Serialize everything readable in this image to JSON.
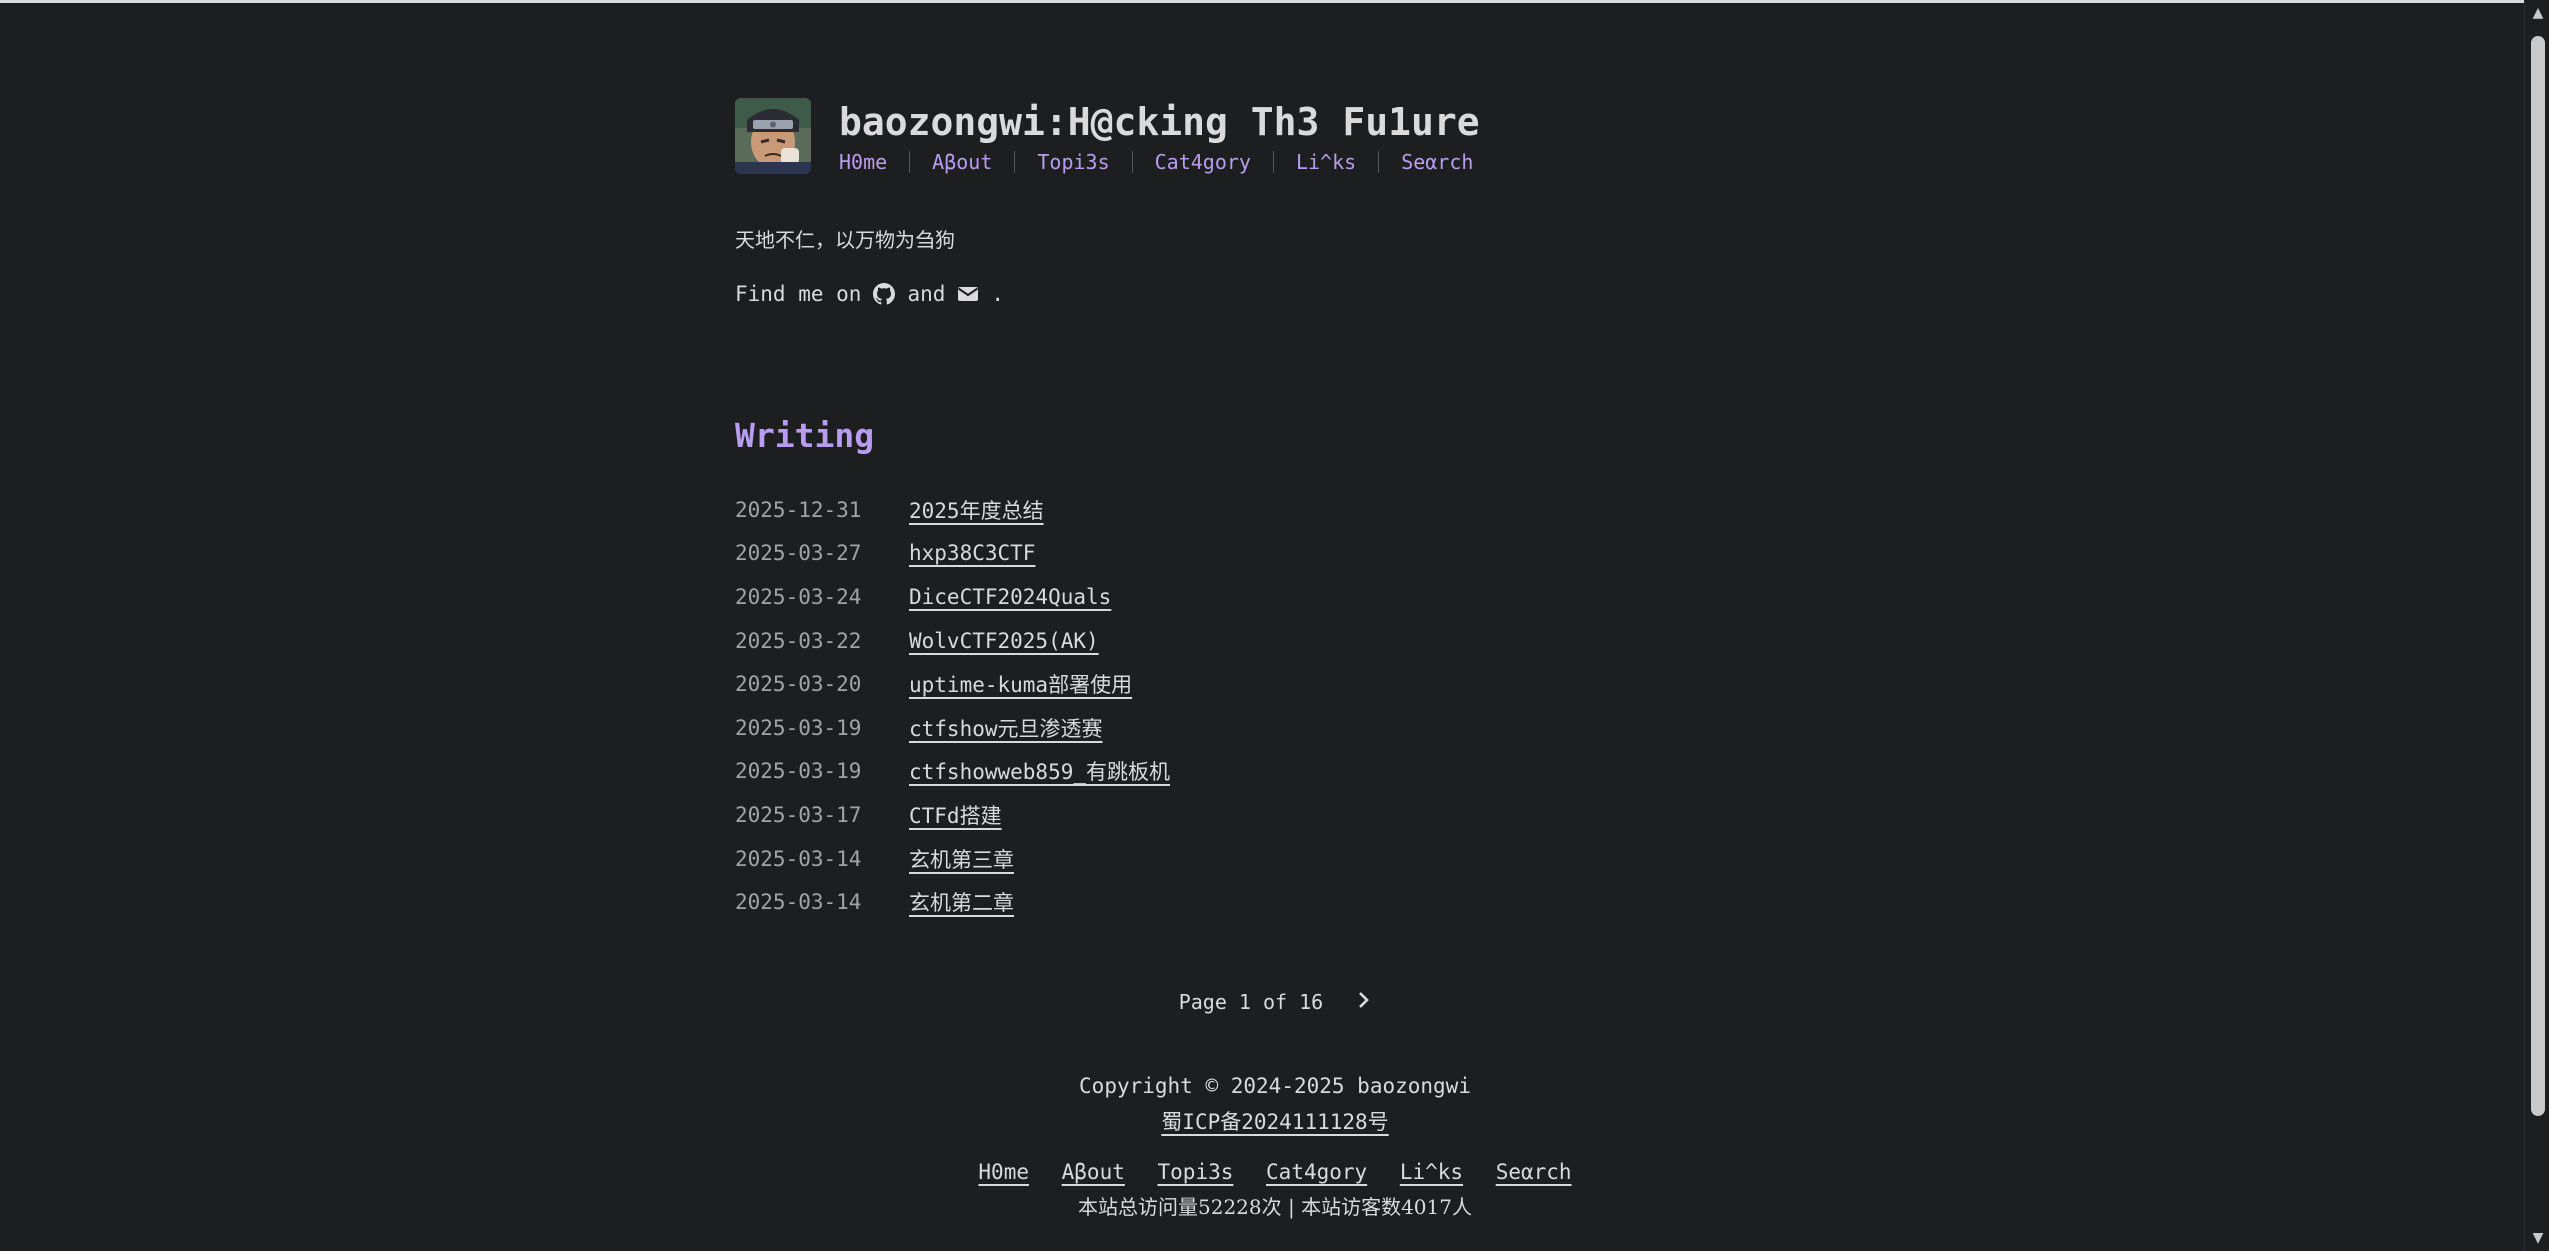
{
  "header": {
    "title": "baozongwi:H@cking Th3 Fu1ure",
    "nav": [
      "H0me",
      "Aβout",
      "Topi3s",
      "Cat4gory",
      "Li^ks",
      "Seαrch"
    ]
  },
  "intro": {
    "motto": "天地不仁，以万物为刍狗",
    "find_me_prefix": "Find me on",
    "find_me_and": "and",
    "find_me_suffix": ".",
    "icons": [
      "github-icon",
      "mail-icon"
    ]
  },
  "section_title": "Writing",
  "posts": [
    {
      "date": "2025-12-31",
      "title": "2025年度总结"
    },
    {
      "date": "2025-03-27",
      "title": "hxp38C3CTF"
    },
    {
      "date": "2025-03-24",
      "title": "DiceCTF2024Quals"
    },
    {
      "date": "2025-03-22",
      "title": "WolvCTF2025(AK)"
    },
    {
      "date": "2025-03-20",
      "title": "uptime-kuma部署使用"
    },
    {
      "date": "2025-03-19",
      "title": "ctfshow元旦渗透赛"
    },
    {
      "date": "2025-03-19",
      "title": "ctfshowweb859_有跳板机"
    },
    {
      "date": "2025-03-17",
      "title": "CTFd搭建"
    },
    {
      "date": "2025-03-14",
      "title": "玄机第三章"
    },
    {
      "date": "2025-03-14",
      "title": "玄机第二章"
    }
  ],
  "pagination": {
    "label": "Page 1 of 16",
    "next_icon": "chevron-right-icon"
  },
  "footer": {
    "copyright": "Copyright © 2024-2025 baozongwi",
    "icp": "蜀ICP备2024111128号",
    "nav": [
      "H0me",
      "Aβout",
      "Topi3s",
      "Cat4gory",
      "Li^ks",
      "Seαrch"
    ],
    "stats": "本站总访问量52228次 | 本站访客数4017人"
  },
  "colors": {
    "background": "#1d1e20",
    "text": "#dadadb",
    "accent": "#b99cf0",
    "muted": "#a3a3a6"
  }
}
